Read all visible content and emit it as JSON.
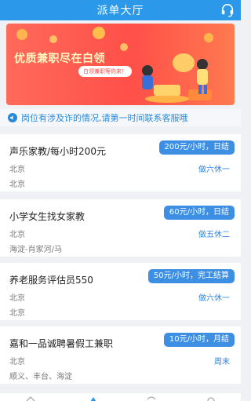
{
  "header": {
    "title": "派单大厅",
    "right_icon": "headset-icon"
  },
  "banner": {
    "headline": "优质兼职尽在白领",
    "pill": "白领兼职等你来！"
  },
  "notice": {
    "icon": "speaker-icon",
    "text": "岗位有涉及诈的情况,请第一时间联系客服哦"
  },
  "jobs": [
    {
      "title": "声乐家教/每小时200元",
      "salary": "200元/小时，日结",
      "city": "北京",
      "area": "北京",
      "schedule": "做六休一"
    },
    {
      "title": "小学女生找女家教",
      "salary": "60元/小时，日结",
      "city": "北京",
      "area": "海淀-肖家河/马",
      "schedule": "做五休二"
    },
    {
      "title": "养老服务评估员550",
      "salary": "50元/小时，完工结算",
      "city": "北京",
      "area": "北京",
      "schedule": "做六休一"
    },
    {
      "title": "嘉和一品诚聘暑假工兼职",
      "salary": "10元/小时，月结",
      "city": "北京",
      "area": "顺义、丰台、海淀",
      "schedule": "周末"
    }
  ],
  "colors": {
    "primary": "#2b98ea",
    "banner": "#ff4f49",
    "salary_badge": "#3d8fe4"
  }
}
